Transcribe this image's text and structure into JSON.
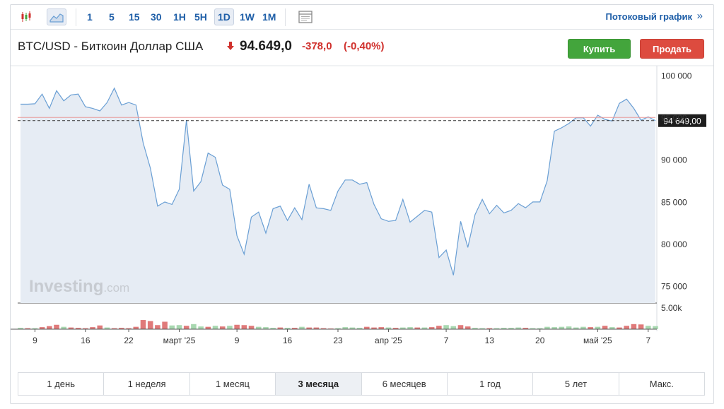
{
  "toolbar": {
    "intervals": [
      "1",
      "5",
      "15",
      "30",
      "1H",
      "5H",
      "1D",
      "1W",
      "1M"
    ],
    "active_interval": "1D",
    "stream_label": "Потоковый график",
    "stream_arrow": "»"
  },
  "header": {
    "pair_title": "BTC/USD - Биткоин Доллар США",
    "price": "94.649,0",
    "change": "-378,0",
    "change_pct": "(-0,40%)",
    "buy_label": "Купить",
    "sell_label": "Продать"
  },
  "colors": {
    "line": "#6a9fd4",
    "area": "#e6ecf4",
    "up_volume": "#a8d8b0",
    "down_volume": "#e07a7a",
    "down_price": "#d0312d",
    "buy": "#43a53c",
    "sell": "#dd4b3f"
  },
  "chart_data": {
    "type": "line",
    "title": "BTC/USD",
    "y_ticks": [
      "100 000",
      "95 000",
      "90 000",
      "85 000",
      "80 000",
      "75 000"
    ],
    "y_tick_values": [
      100000,
      95000,
      90000,
      85000,
      80000,
      75000
    ],
    "ylim": [
      73000,
      101000
    ],
    "current_price_label": "94 649,00",
    "current_price": 94649,
    "reference_line": 95027,
    "x_tick_labels": [
      "9",
      "16",
      "22",
      "март '25",
      "9",
      "16",
      "23",
      "апр '25",
      "7",
      "13",
      "20",
      "май '25",
      "7"
    ],
    "x_tick_index": [
      2,
      9,
      15,
      22,
      30,
      37,
      44,
      51,
      59,
      65,
      72,
      80,
      87
    ],
    "values": [
      96600,
      96600,
      96650,
      97800,
      96100,
      98200,
      97000,
      97700,
      97800,
      96300,
      96100,
      95800,
      96800,
      98500,
      96500,
      96800,
      96500,
      92000,
      89000,
      84500,
      85000,
      84700,
      86500,
      94700,
      86300,
      87400,
      90800,
      90300,
      87000,
      86500,
      81000,
      78800,
      83200,
      83800,
      81300,
      84200,
      84500,
      82800,
      84300,
      82900,
      87100,
      84300,
      84200,
      84000,
      86300,
      87600,
      87600,
      87100,
      87300,
      84700,
      83000,
      82700,
      82800,
      85300,
      82600,
      83300,
      84000,
      83800,
      78400,
      79300,
      76300,
      82700,
      79600,
      83500,
      85300,
      83600,
      84600,
      83700,
      84000,
      84800,
      84300,
      85000,
      85000,
      87500,
      93400,
      93800,
      94300,
      95000,
      95000,
      94000,
      95300,
      94800,
      94600,
      96700,
      97200,
      96100,
      94700,
      95100,
      94649
    ],
    "volume_label": "5.00k",
    "volume_max": 5000,
    "volumes": [
      400,
      300,
      300,
      600,
      900,
      1300,
      700,
      500,
      400,
      300,
      600,
      1100,
      500,
      300,
      400,
      300,
      700,
      2700,
      2400,
      1200,
      2200,
      1100,
      1200,
      1000,
      1500,
      800,
      700,
      1000,
      800,
      1000,
      1300,
      1200,
      1000,
      700,
      600,
      400,
      500,
      400,
      400,
      700,
      500,
      500,
      300,
      200,
      300,
      600,
      500,
      400,
      700,
      500,
      600,
      500,
      400,
      500,
      600,
      500,
      500,
      600,
      1000,
      1200,
      900,
      1200,
      800,
      400,
      300,
      300,
      300,
      400,
      400,
      500,
      400,
      300,
      300,
      700,
      600,
      700,
      800,
      500,
      700,
      600,
      700,
      1000,
      600,
      500,
      1000,
      1500,
      1400,
      1000,
      900
    ],
    "volume_down": [
      false,
      true,
      false,
      true,
      true,
      true,
      false,
      true,
      true,
      true,
      true,
      true,
      false,
      true,
      true,
      true,
      true,
      true,
      true,
      true,
      true,
      false,
      false,
      true,
      false,
      false,
      true,
      false,
      true,
      false,
      true,
      true,
      true,
      false,
      false,
      false,
      true,
      false,
      true,
      false,
      true,
      true,
      true,
      true,
      false,
      false,
      false,
      false,
      true,
      true,
      true,
      false,
      true,
      false,
      false,
      true,
      false,
      true,
      true,
      false,
      false,
      true,
      true,
      false,
      false,
      true,
      false,
      false,
      false,
      false,
      true,
      false,
      false,
      false,
      false,
      false,
      false,
      false,
      false,
      true,
      false,
      true,
      false,
      true,
      true,
      true,
      true,
      false,
      false
    ]
  },
  "watermark": "Investing.com",
  "ranges": [
    "1 день",
    "1 неделя",
    "1 месяц",
    "3 месяца",
    "6 месяцев",
    "1 год",
    "5 лет",
    "Макс."
  ],
  "active_range": "3 месяца"
}
